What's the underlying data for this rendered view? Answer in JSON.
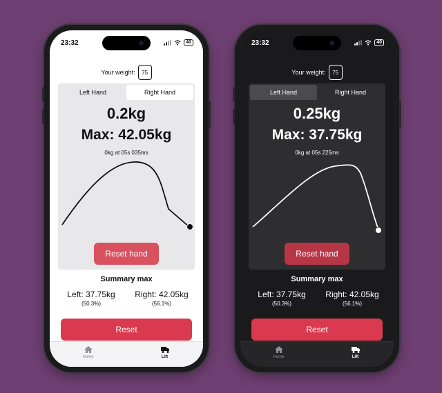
{
  "colors": {
    "background": "#6e3f72",
    "accent": "#d93a4f"
  },
  "light": {
    "time": "23:32",
    "battery": "40",
    "weight_label": "Your weight:",
    "weight_value": "75",
    "tabs": [
      "Left Hand",
      "Right Hand"
    ],
    "active_tab": "Right Hand",
    "current": "0.2kg",
    "max": "Max: 42.05kg",
    "time_note": "0kg at 05s 035ms",
    "reset_hand": "Reset hand",
    "summary_title": "Summary max",
    "left_main": "Left: 37.75kg",
    "left_pct": "(50.3%)",
    "right_main": "Right: 42.05kg",
    "right_pct": "(56.1%)",
    "reset": "Reset",
    "nav": [
      {
        "label": "Home",
        "icon": "home-icon"
      },
      {
        "label": "Lift",
        "icon": "truck-icon"
      }
    ]
  },
  "dark": {
    "time": "23:32",
    "battery": "40",
    "weight_label": "Your weight:",
    "weight_value": "75",
    "tabs": [
      "Left Hand",
      "Right Hand"
    ],
    "active_tab": "Left Hand",
    "current": "0.25kg",
    "max": "Max: 37.75kg",
    "time_note": "0kg at 05s 225ms",
    "reset_hand": "Reset hand",
    "summary_title": "Summary max",
    "left_main": "Left: 37.75kg",
    "left_pct": "(50.3%)",
    "right_main": "Right: 42.05kg",
    "right_pct": "(56.1%)",
    "reset": "Reset",
    "nav": [
      {
        "label": "Home",
        "icon": "home-icon"
      },
      {
        "label": "Lift",
        "icon": "truck-icon"
      }
    ]
  }
}
